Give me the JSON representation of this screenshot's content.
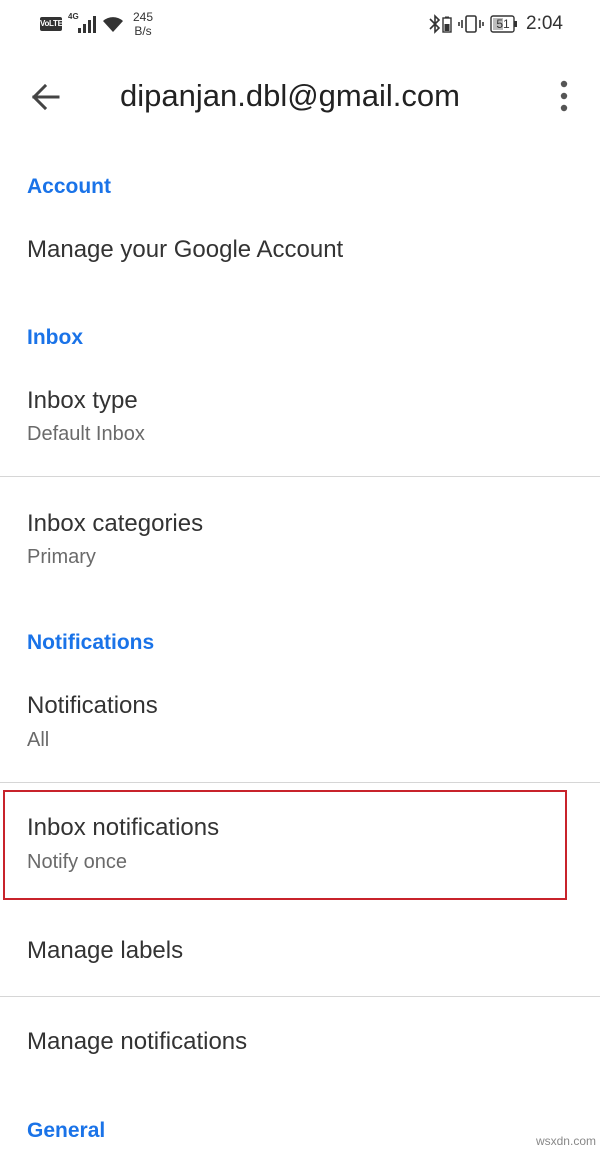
{
  "status_bar": {
    "volte": "VoLTE",
    "network": "4G",
    "speed_value": "245",
    "speed_unit": "B/s",
    "battery": "51",
    "time": "2:04"
  },
  "app_bar": {
    "title": "dipanjan.dbl@gmail.com",
    "back_icon": "arrow-back-icon",
    "menu_icon": "more-vert-icon"
  },
  "sections": {
    "account": {
      "header": "Account",
      "items": [
        {
          "title": "Manage your Google Account"
        }
      ]
    },
    "inbox": {
      "header": "Inbox",
      "items": [
        {
          "title": "Inbox type",
          "subtitle": "Default Inbox"
        },
        {
          "title": "Inbox categories",
          "subtitle": "Primary"
        }
      ]
    },
    "notifications": {
      "header": "Notifications",
      "items": [
        {
          "title": "Notifications",
          "subtitle": "All"
        },
        {
          "title": "Inbox notifications",
          "subtitle": "Notify once"
        },
        {
          "title": "Manage labels"
        },
        {
          "title": "Manage notifications"
        }
      ]
    },
    "general": {
      "header": "General"
    }
  },
  "colors": {
    "accent": "#1a73e8",
    "highlight": "#c8232b",
    "divider": "#d6d6d6"
  },
  "watermark": "wsxdn.com"
}
